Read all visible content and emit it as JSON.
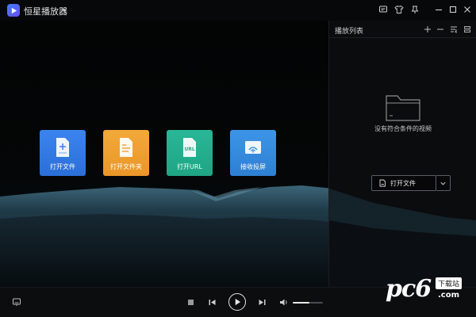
{
  "app": {
    "title": "恒星播放器",
    "accent": "#3f7dff"
  },
  "titlebar_icons": [
    "chat-icon",
    "shirt-icon",
    "pin-icon",
    "minimize-icon",
    "maximize-icon",
    "close-icon"
  ],
  "tiles": [
    {
      "label": "打开文件",
      "icon": "file-plus-icon",
      "color": "#3b84f0"
    },
    {
      "label": "打开文件夹",
      "icon": "folder-icon",
      "color": "#f3a93a"
    },
    {
      "label": "打开URL",
      "icon": "url-file-icon",
      "color": "#28b796"
    },
    {
      "label": "接收投屏",
      "icon": "cast-icon",
      "color": "#3d95e8"
    }
  ],
  "playlist": {
    "title": "播放列表",
    "empty_text": "没有符合条件的视频",
    "open_button_label": "打开文件"
  },
  "controls": {
    "volume": 0.55
  },
  "watermark": {
    "text": "pc6",
    "badge": "下载站",
    "domain": ".com"
  }
}
